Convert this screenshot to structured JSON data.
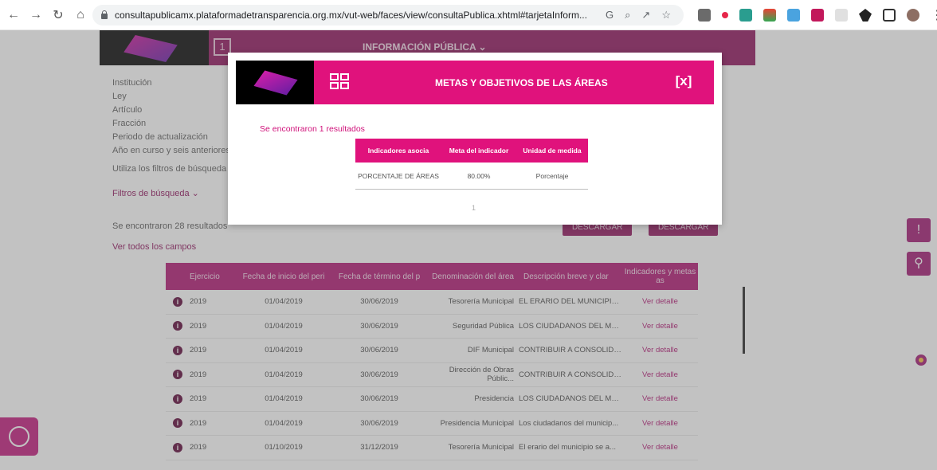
{
  "browser": {
    "url": "consultapublicamx.plataformadetransparencia.org.mx/vut-web/faces/view/consultaPublica.xhtml#tarjetaInform..."
  },
  "header": {
    "menu_label": "INFORMACIÓN PÚBLICA ⌄",
    "icon_label": "1"
  },
  "filters": {
    "labels": [
      "Institución",
      "Ley",
      "Artículo",
      "Fracción",
      "Periodo de actualización",
      "Año en curso y seis anteriores"
    ],
    "hint": "Utiliza los filtros de búsqueda",
    "toggle": "Filtros de búsqueda ⌄"
  },
  "results": {
    "count_text": "Se encontraron 28 resultados",
    "show_all": "Ver todos los campos",
    "download_1": "DESCARGAR",
    "download_2": "DESCARGAR"
  },
  "table": {
    "headers": [
      "Ejercicio",
      "Fecha de inicio del peri",
      "Fecha de término del p",
      "Denominación del área",
      "Descripción breve y clar",
      "Indicadores y metas as"
    ],
    "rows": [
      {
        "year": "2019",
        "start": "01/04/2019",
        "end": "30/06/2019",
        "area": "Tesorería Municipal",
        "desc": "EL ERARIO DEL MUNICIPIO...",
        "link": "Ver detalle"
      },
      {
        "year": "2019",
        "start": "01/04/2019",
        "end": "30/06/2019",
        "area": "Seguridad Pública",
        "desc": "LOS CIUDADANOS DEL MU...",
        "link": "Ver detalle"
      },
      {
        "year": "2019",
        "start": "01/04/2019",
        "end": "30/06/2019",
        "area": "DIF Municipal",
        "desc": "CONTRIBUIR A CONSOLIDA...",
        "link": "Ver detalle"
      },
      {
        "year": "2019",
        "start": "01/04/2019",
        "end": "30/06/2019",
        "area": "Dirección de Obras Públic...",
        "desc": "CONTRIBUIR A CONSOLIDA...",
        "link": "Ver detalle"
      },
      {
        "year": "2019",
        "start": "01/04/2019",
        "end": "30/06/2019",
        "area": "Presidencia",
        "desc": "LOS CIUDADANOS DEL MU...",
        "link": "Ver detalle"
      },
      {
        "year": "2019",
        "start": "01/04/2019",
        "end": "30/06/2019",
        "area": "Presidencia Municipal",
        "desc": "Los ciudadanos del municip...",
        "link": "Ver detalle"
      },
      {
        "year": "2019",
        "start": "01/10/2019",
        "end": "31/12/2019",
        "area": "Tesorería Municipal",
        "desc": "El erario del municipio se a...",
        "link": "Ver detalle"
      }
    ]
  },
  "modal": {
    "title": "METAS Y OBJETIVOS DE LAS ÁREAS",
    "close_label": "[x]",
    "found_text": "Se encontraron 1 resultados",
    "headers": [
      "Indicadores asocia",
      "Meta del indicador",
      "Unidad de medida"
    ],
    "rows": [
      {
        "c1": "PORCENTAJE DE ÁREAS",
        "c2": "80.00%",
        "c3": "Porcentaje"
      }
    ],
    "page": "1"
  },
  "colors": {
    "brand": "#e0127c",
    "brand_dark": "#8e0f5a"
  }
}
